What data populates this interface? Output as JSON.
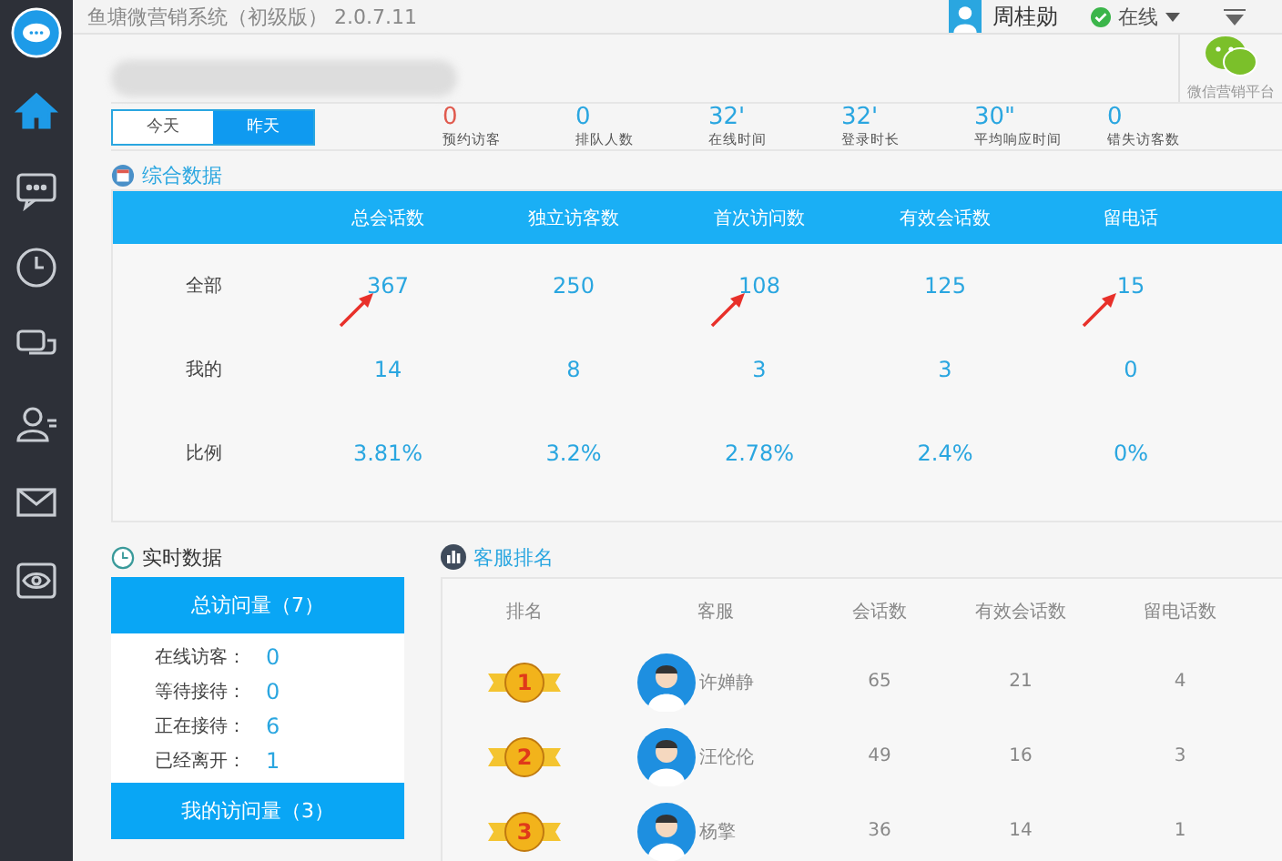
{
  "window": {
    "title": "鱼塘微营销系统（初级版） 2.0.7.11"
  },
  "user": {
    "name": "周桂勋",
    "status": "在线"
  },
  "sidebar": {
    "items": [
      {
        "kind": "home",
        "selected": true
      },
      {
        "kind": "chat",
        "selected": false
      },
      {
        "kind": "clock",
        "selected": false
      },
      {
        "kind": "bubbles",
        "selected": false
      },
      {
        "kind": "user",
        "selected": false
      },
      {
        "kind": "mail",
        "selected": false
      },
      {
        "kind": "eye",
        "selected": false
      }
    ]
  },
  "wechat_platform": {
    "label": "微信营销平台"
  },
  "tabs": [
    {
      "label": "今天",
      "selected": false
    },
    {
      "label": "昨天",
      "selected": true
    }
  ],
  "stats": [
    {
      "value": "0",
      "label": "预约访客",
      "color": "#e05a4e"
    },
    {
      "value": "0",
      "label": "排队人数",
      "color": "#2aa6e0"
    },
    {
      "value": "32'",
      "label": "在线时间",
      "color": "#2aa6e0"
    },
    {
      "value": "32'",
      "label": "登录时长",
      "color": "#2aa6e0"
    },
    {
      "value": "30\"",
      "label": "平均响应时间",
      "color": "#2aa6e0"
    },
    {
      "value": "0",
      "label": "错失访客数",
      "color": "#2aa6e0"
    }
  ],
  "summary": {
    "title": "综合数据",
    "columns": [
      "总会话数",
      "独立访客数",
      "首次访问数",
      "有效会话数",
      "留电话"
    ],
    "rows": [
      {
        "label": "全部",
        "cells": [
          {
            "value": "367",
            "arrow": true
          },
          {
            "value": "250",
            "arrow": false
          },
          {
            "value": "108",
            "arrow": true
          },
          {
            "value": "125",
            "arrow": false
          },
          {
            "value": "15",
            "arrow": true
          }
        ]
      },
      {
        "label": "我的",
        "cells": [
          {
            "value": "14",
            "arrow": false
          },
          {
            "value": "8",
            "arrow": false
          },
          {
            "value": "3",
            "arrow": false
          },
          {
            "value": "3",
            "arrow": false
          },
          {
            "value": "0",
            "arrow": false
          }
        ]
      },
      {
        "label": "比例",
        "cells": [
          {
            "value": "3.81%",
            "arrow": false
          },
          {
            "value": "3.2%",
            "arrow": false
          },
          {
            "value": "2.78%",
            "arrow": false
          },
          {
            "value": "2.4%",
            "arrow": false
          },
          {
            "value": "0%",
            "arrow": false
          }
        ]
      }
    ]
  },
  "realtime": {
    "title": "实时数据",
    "groups": [
      {
        "heading": "总访问量（7）",
        "items": [
          {
            "label": "在线访客：",
            "value": "0"
          },
          {
            "label": "等待接待：",
            "value": "0"
          },
          {
            "label": "正在接待：",
            "value": "6"
          },
          {
            "label": "已经离开：",
            "value": "1"
          }
        ]
      },
      {
        "heading": "我的访问量（3）"
      }
    ]
  },
  "ranking": {
    "title": "客服排名",
    "columns": [
      "排名",
      "客服",
      "会话数",
      "有效会话数",
      "留电话数"
    ],
    "rows": [
      {
        "rank": "1",
        "name": "许婵静",
        "sessions": "65",
        "valid": "21",
        "phone": "4"
      },
      {
        "rank": "2",
        "name": "汪伦伦",
        "sessions": "49",
        "valid": "16",
        "phone": "3"
      },
      {
        "rank": "3",
        "name": "杨擎",
        "sessions": "36",
        "valid": "14",
        "phone": "1"
      }
    ]
  }
}
